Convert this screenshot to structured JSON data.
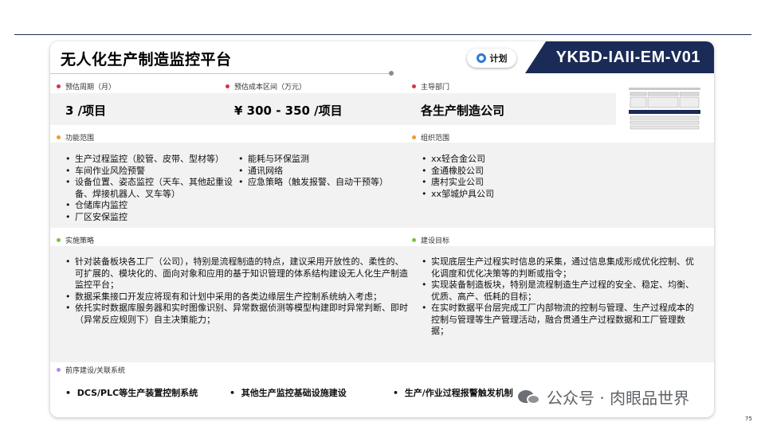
{
  "header": {
    "title": "无人化生产制造监控平台",
    "status_label": "计划",
    "code": "YKBD-IAII-EM-V01"
  },
  "summary": {
    "period_label": "预估周期（月）",
    "period_value": "3 /项目",
    "cost_label": "预估成本区间（万元）",
    "cost_value": "¥ 300 - 350 /项目",
    "dept_label": "主导部门",
    "dept_value": "各生产制造公司"
  },
  "function_scope": {
    "label": "功能范围",
    "col1": [
      "生产过程监控（胶管、皮带、型材等）",
      "车间作业风险预警",
      "设备位置、姿态监控（天车、其他起重设备、焊接机器人、叉车等）",
      "仓储库内监控",
      "厂区安保监控"
    ],
    "col2": [
      "能耗与环保监测",
      "通讯网络",
      "应急策略（触发报警、自动干预等）"
    ]
  },
  "org_scope": {
    "label": "组织范围",
    "items": [
      "xx轻合金公司",
      "金通橡胶公司",
      "唐村实业公司",
      "xx邹城炉具公司"
    ]
  },
  "strategy": {
    "label": "实施策略",
    "items": [
      "针对装备板块各工厂（公司），特别是流程制造的特点，建议采用开放性的、柔性的、可扩展的、模块化的、面向对象和应用的基于知识管理的体系结构建设无人化生产制造监控平台；",
      "数据采集接口开发应将现有和计划中采用的各类边缘层生产控制系统纳入考虑；",
      "依托实时数据库服务器和实时图像识别、异常数据侦测等模型构建即时异常判断、即时（异常反应规则下）自主决策能力；"
    ]
  },
  "goals": {
    "label": "建设目标",
    "items": [
      "实现底层生产过程实时信息的采集，通过信息集成形成优化控制、优化调度和优化决策等的判断或指令；",
      "实现装备制造板块，特别是流程制造生产过程的安全、稳定、均衡、优质、高产、低耗的目标；",
      "在实时数据平台层完成工厂内部物流的控制与管理、生产过程成本的控制与管理等生产管理活动，融合贯通生产过程数据和工厂管理数据；"
    ]
  },
  "prereq": {
    "label": "前序建设/关联系统",
    "items": [
      "DCS/PLC等生产装置控制系统",
      "其他生产监控基础设施建设",
      "生产/作业过程报警触发机制"
    ]
  },
  "watermark": "公众号 · 肉眼品世界",
  "page_number": "75",
  "colors": {
    "navy": "#1b2b57",
    "dot_red": "#d9304a",
    "dot_orange": "#f29a2e",
    "dot_green": "#7cc142",
    "dot_purple": "#b48ae6",
    "accent_blue": "#2f7ad1",
    "band_gray": "#f2f2f2"
  }
}
